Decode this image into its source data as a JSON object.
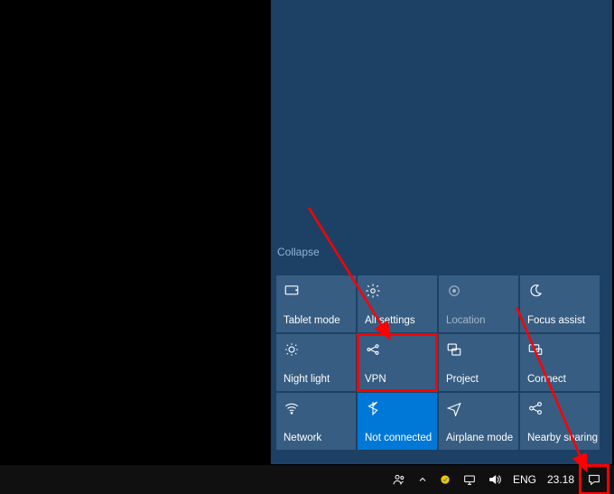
{
  "action_center": {
    "collapse_label": "Collapse",
    "tiles": [
      {
        "id": "tablet-mode",
        "label": "Tablet mode",
        "icon": "tablet-icon",
        "state": "normal"
      },
      {
        "id": "all-settings",
        "label": "All settings",
        "icon": "gear-icon",
        "state": "normal"
      },
      {
        "id": "location",
        "label": "Location",
        "icon": "location-icon",
        "state": "disabled"
      },
      {
        "id": "focus-assist",
        "label": "Focus assist",
        "icon": "moon-icon",
        "state": "normal"
      },
      {
        "id": "night-light",
        "label": "Night light",
        "icon": "sun-icon",
        "state": "normal"
      },
      {
        "id": "vpn",
        "label": "VPN",
        "icon": "vpn-icon",
        "state": "normal",
        "highlight": true
      },
      {
        "id": "project",
        "label": "Project",
        "icon": "project-icon",
        "state": "normal"
      },
      {
        "id": "connect",
        "label": "Connect",
        "icon": "connect-icon",
        "state": "normal"
      },
      {
        "id": "network",
        "label": "Network",
        "icon": "wifi-icon",
        "state": "normal"
      },
      {
        "id": "bluetooth",
        "label": "Not connected",
        "icon": "bluetooth-icon",
        "state": "active"
      },
      {
        "id": "airplane-mode",
        "label": "Airplane mode",
        "icon": "airplane-icon",
        "state": "normal"
      },
      {
        "id": "nearby-sharing",
        "label": "Nearby sharing",
        "icon": "share-icon",
        "state": "normal"
      }
    ]
  },
  "taskbar": {
    "ime": "ENG",
    "clock": "23.18"
  }
}
